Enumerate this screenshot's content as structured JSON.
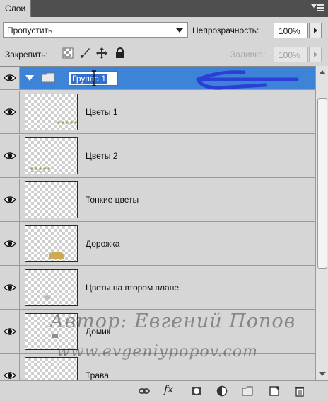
{
  "panel": {
    "tab_label": "Слои"
  },
  "blend_mode": {
    "value": "Пропустить"
  },
  "opacity": {
    "label": "Непрозрачность:",
    "value": "100%"
  },
  "lock": {
    "label": "Закрепить:",
    "icons": [
      "transparency-lock-icon",
      "brush-lock-icon",
      "move-lock-icon",
      "padlock-icon"
    ]
  },
  "fill": {
    "label": "Заливка:",
    "value": "100%"
  },
  "group": {
    "name": "Группа 1",
    "expanded": true,
    "selected": true,
    "selection_color": "#3d83d8"
  },
  "layers": [
    {
      "name": "Цветы 1"
    },
    {
      "name": "Цветы 2"
    },
    {
      "name": "Тонкие цветы"
    },
    {
      "name": "Дорожка"
    },
    {
      "name": "Цветы на втором плане"
    },
    {
      "name": "Домик"
    },
    {
      "name": "Трава"
    }
  ],
  "watermark": {
    "line1": "Автор: Евгений Попов",
    "line2": "www.evgeniypopov.com"
  },
  "toolbar": {
    "icons": [
      "link-layers-icon",
      "fx-icon",
      "add-mask-icon",
      "adjustment-layer-icon",
      "new-group-icon",
      "new-layer-icon",
      "trash-icon"
    ],
    "fx_label": "fx"
  },
  "annotation": {
    "scribble_color": "#2b3fd6"
  }
}
